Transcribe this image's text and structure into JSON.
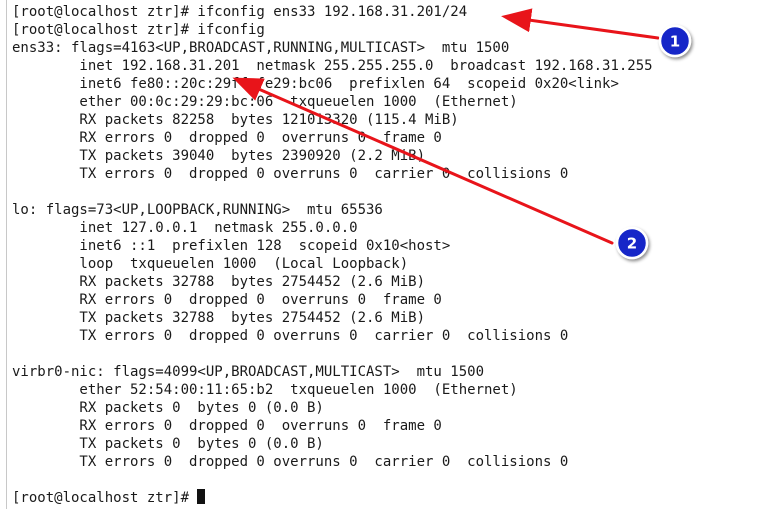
{
  "terminal": {
    "lines": [
      "[root@localhost ztr]# ifconfig ens33 192.168.31.201/24",
      "[root@localhost ztr]# ifconfig",
      "ens33: flags=4163<UP,BROADCAST,RUNNING,MULTICAST>  mtu 1500",
      "        inet 192.168.31.201  netmask 255.255.255.0  broadcast 192.168.31.255",
      "        inet6 fe80::20c:29ff:fe29:bc06  prefixlen 64  scopeid 0x20<link>",
      "        ether 00:0c:29:29:bc:06  txqueuelen 1000  (Ethernet)",
      "        RX packets 82258  bytes 121013320 (115.4 MiB)",
      "        RX errors 0  dropped 0  overruns 0  frame 0",
      "        TX packets 39040  bytes 2390920 (2.2 MiB)",
      "        TX errors 0  dropped 0 overruns 0  carrier 0  collisions 0",
      "",
      "lo: flags=73<UP,LOOPBACK,RUNNING>  mtu 65536",
      "        inet 127.0.0.1  netmask 255.0.0.0",
      "        inet6 ::1  prefixlen 128  scopeid 0x10<host>",
      "        loop  txqueuelen 1000  (Local Loopback)",
      "        RX packets 32788  bytes 2754452 (2.6 MiB)",
      "        RX errors 0  dropped 0  overruns 0  frame 0",
      "        TX packets 32788  bytes 2754452 (2.6 MiB)",
      "        TX errors 0  dropped 0 overruns 0  carrier 0  collisions 0",
      "",
      "virbr0-nic: flags=4099<UP,BROADCAST,MULTICAST>  mtu 1500",
      "        ether 52:54:00:11:65:b2  txqueuelen 1000  (Ethernet)",
      "        RX packets 0  bytes 0 (0.0 B)",
      "        RX errors 0  dropped 0  overruns 0  frame 0",
      "        TX packets 0  bytes 0 (0.0 B)",
      "        TX errors 0  dropped 0 overruns 0  carrier 0  collisions 0",
      "",
      "[root@localhost ztr]# "
    ]
  },
  "annotations": {
    "badge_1": "1",
    "badge_2": "2"
  },
  "colors": {
    "arrow": "#e8141a",
    "badge_fill": "#1428c8",
    "text": "#1a1a1a",
    "background": "#ffffff"
  }
}
